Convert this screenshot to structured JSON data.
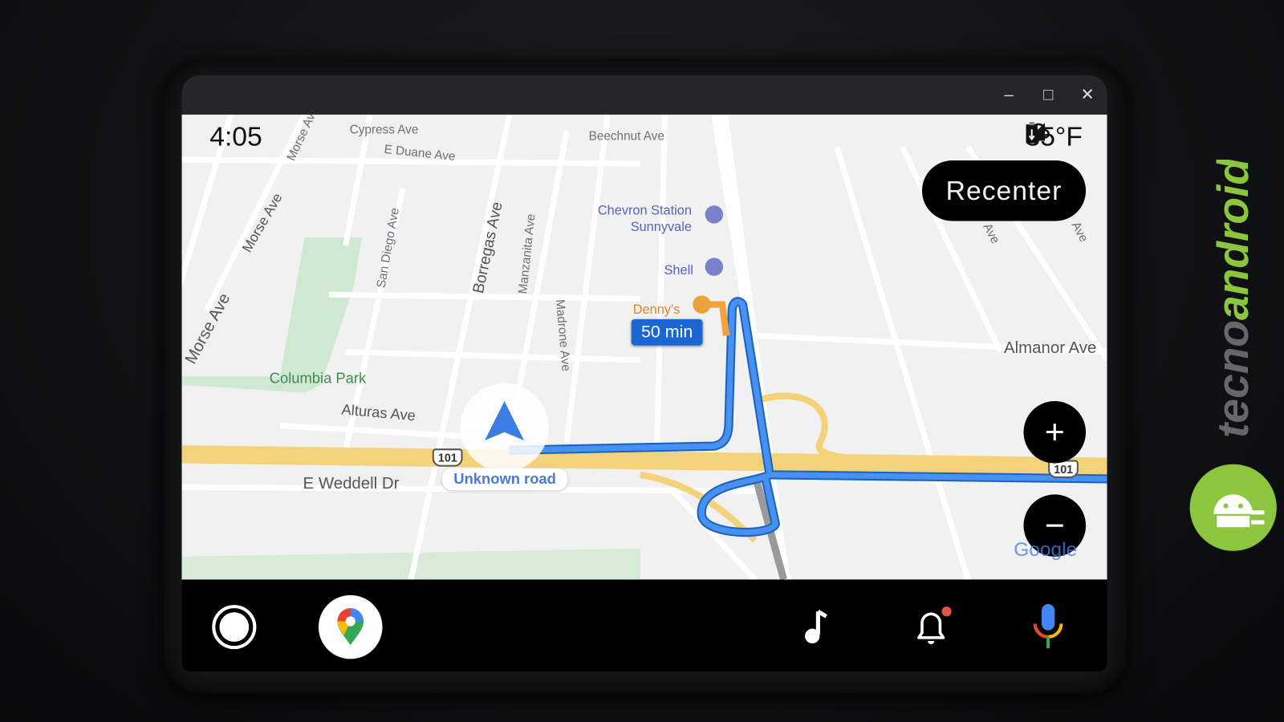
{
  "window": {
    "controls": {
      "minimize": "–",
      "maximize": "□",
      "close": "✕"
    }
  },
  "status_bar": {
    "time": "4:05",
    "weather_icon": "cloud-icon",
    "temperature": "35°F",
    "signal_icon": "cellular-signal-icon",
    "battery_icon": "battery-charging-icon"
  },
  "map": {
    "recenter_label": "Recenter",
    "zoom_in_label": "+",
    "zoom_out_label": "−",
    "eta_label": "50 min",
    "current_road": "Unknown road",
    "highway_shield": "101",
    "attribution": "Google",
    "streets": [
      "Cypress Ave",
      "E Duane Ave",
      "Beechnut Ave",
      "Morse Ave",
      "Morse Ave",
      "Morse Ave",
      "San Diego Ave",
      "Borregas Ave",
      "Manzanita Ave",
      "Madrone Ave",
      "Alturas Ave",
      "E Weddell Dr",
      "Almanor Ave",
      "Ave",
      "Ave"
    ],
    "park": "Columbia Park",
    "pois": [
      {
        "name": "Chevron Station Sunnyvale",
        "line1": "Chevron Station",
        "line2": "Sunnyvale",
        "icon": "gas-station-icon"
      },
      {
        "name": "Shell",
        "icon": "gas-station-icon"
      },
      {
        "name": "Denny's",
        "icon": "restaurant-icon"
      }
    ],
    "colors": {
      "route": "#4a90f0",
      "highway": "#f4d27a",
      "park": "#cfe8d2",
      "background": "#f1f1f1"
    }
  },
  "bottom_bar": {
    "items": [
      "home-launcher-icon",
      "google-maps-app-icon",
      "music-icon",
      "notification-bell-icon",
      "microphone-icon"
    ],
    "notification_dot_color": "#e05545"
  },
  "watermark": {
    "text": "tecnoandroid",
    "color": "#8cc63f"
  }
}
